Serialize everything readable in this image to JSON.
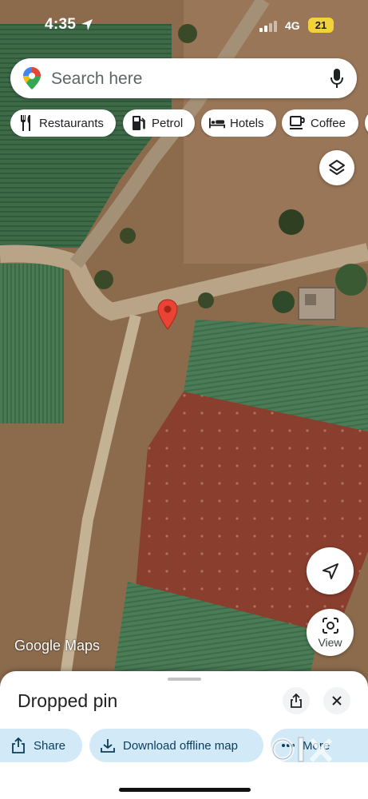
{
  "status_bar": {
    "time": "4:35",
    "network": "4G",
    "battery": "21"
  },
  "search": {
    "placeholder": "Search here"
  },
  "chips": [
    {
      "label": "Restaurants",
      "icon": "fork-knife-icon"
    },
    {
      "label": "Petrol",
      "icon": "fuel-pump-icon"
    },
    {
      "label": "Hotels",
      "icon": "bed-icon"
    },
    {
      "label": "Coffee",
      "icon": "coffee-cup-icon"
    }
  ],
  "map": {
    "type": "satellite",
    "watermark": "Google Maps",
    "pin_color": "#ea4335"
  },
  "controls": {
    "view_label": "View"
  },
  "sheet": {
    "title": "Dropped pin",
    "actions": [
      {
        "label": "Share",
        "icon": "share-icon"
      },
      {
        "label": "Download offline map",
        "icon": "download-icon"
      },
      {
        "label": "More",
        "icon": "more-icon"
      }
    ]
  },
  "overlay_watermark": "OLX",
  "colors": {
    "accent_chip": "#d2e9f7",
    "accent_text": "#0b3d5c",
    "battery": "#f2d23b"
  }
}
